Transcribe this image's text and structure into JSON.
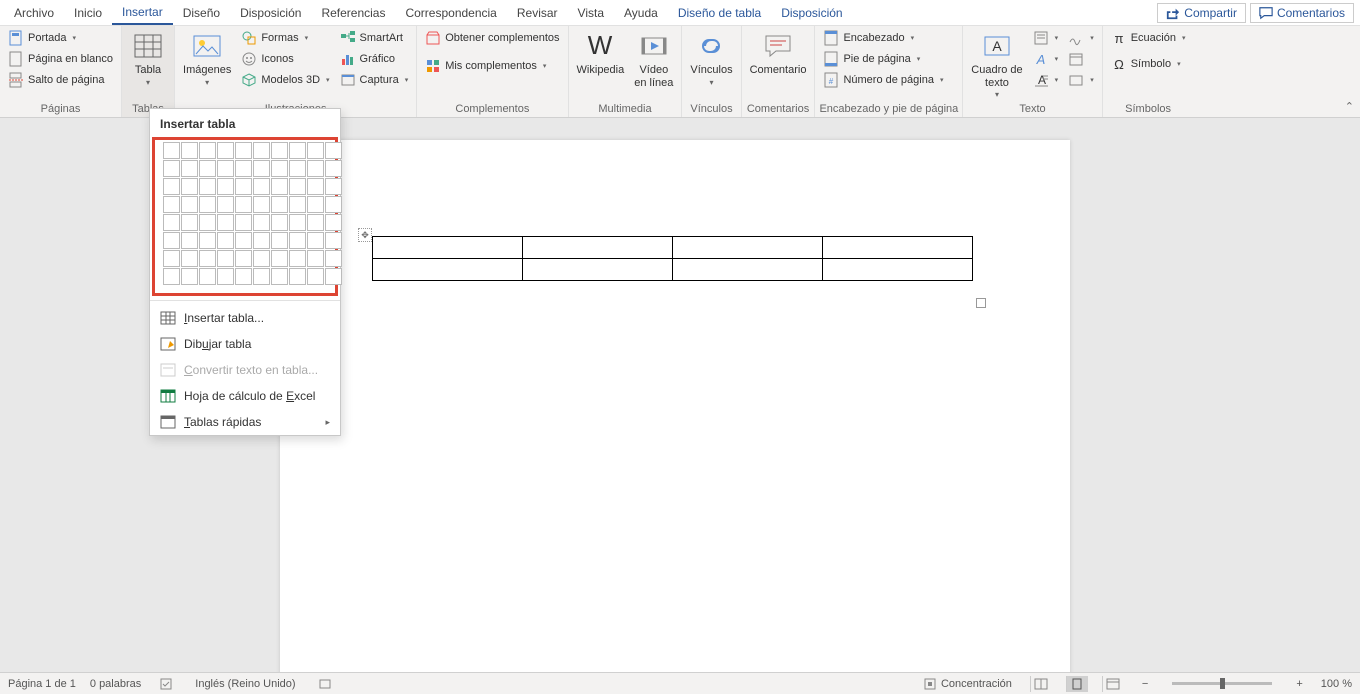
{
  "menubar": {
    "tabs": [
      "Archivo",
      "Inicio",
      "Insertar",
      "Diseño",
      "Disposición",
      "Referencias",
      "Correspondencia",
      "Revisar",
      "Vista",
      "Ayuda"
    ],
    "context_tabs": [
      "Diseño de tabla",
      "Disposición"
    ],
    "active": "Insertar",
    "share": "Compartir",
    "comments": "Comentarios"
  },
  "ribbon": {
    "paginas": {
      "label": "Páginas",
      "portada": "Portada",
      "blanco": "Página en blanco",
      "salto": "Salto de página"
    },
    "tablas": {
      "label": "Tablas",
      "tabla": "Tabla"
    },
    "ilustraciones": {
      "label": "Ilustraciones",
      "imagenes": "Imágenes",
      "formas": "Formas",
      "iconos": "Iconos",
      "modelos3d": "Modelos 3D",
      "smartart": "SmartArt",
      "grafico": "Gráfico",
      "captura": "Captura"
    },
    "complementos": {
      "label": "Complementos",
      "obtener": "Obtener complementos",
      "mis": "Mis complementos"
    },
    "multimedia": {
      "label": "Multimedia",
      "wikipedia": "Wikipedia",
      "video": "Vídeo\nen línea"
    },
    "vinculos": {
      "label": "Vínculos",
      "vinculos": "Vínculos"
    },
    "comentarios": {
      "label": "Comentarios",
      "comentario": "Comentario"
    },
    "encabezado": {
      "label": "Encabezado y pie de página",
      "encabezado": "Encabezado",
      "pie": "Pie de página",
      "numero": "Número de página"
    },
    "texto": {
      "label": "Texto",
      "cuadro": "Cuadro de\ntexto"
    },
    "simbolos": {
      "label": "Símbolos",
      "ecuacion": "Ecuación",
      "simbolo": "Símbolo"
    }
  },
  "dropdown": {
    "title": "Insertar tabla",
    "grid_rows": 8,
    "grid_cols": 10,
    "items": {
      "insertar": "Insertar tabla...",
      "dibujar": "Dibujar tabla",
      "convertir": "Convertir texto en tabla...",
      "excel": "Hoja de cálculo de Excel",
      "rapidas": "Tablas rápidas"
    }
  },
  "document": {
    "table_rows": 2,
    "table_cols": 4
  },
  "statusbar": {
    "page": "Página 1 de 1",
    "words": "0 palabras",
    "lang": "Inglés (Reino Unido)",
    "focus": "Concentración",
    "zoom": "100 %"
  }
}
